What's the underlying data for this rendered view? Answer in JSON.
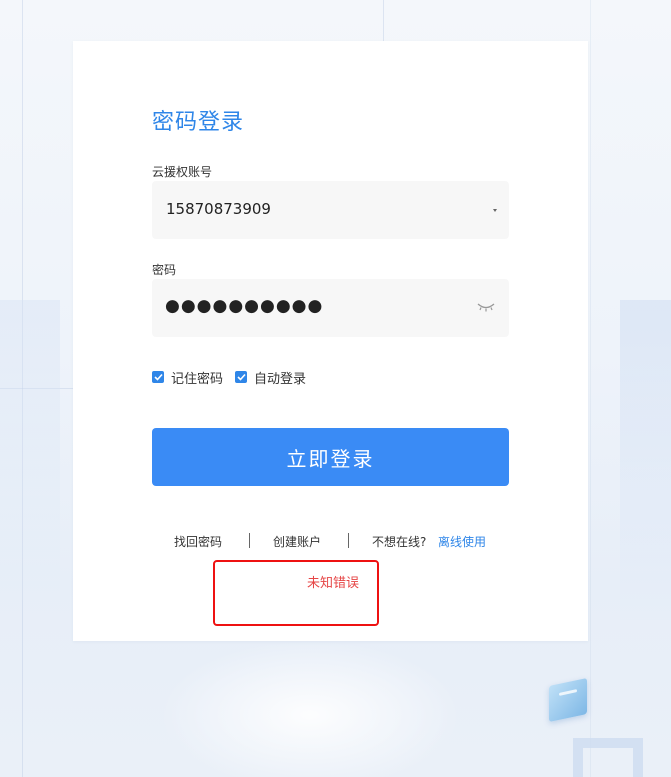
{
  "login": {
    "title": "密码登录",
    "account_label": "云援权账号",
    "account_value": "15870873909",
    "password_label": "密码",
    "password_value": "●●●●●●●●●●",
    "remember_password": {
      "label": "记住密码",
      "checked": true
    },
    "auto_login": {
      "label": "自动登录",
      "checked": true
    },
    "submit_label": "立即登录"
  },
  "links": {
    "recover_password": "找回密码",
    "create_account": "创建账户",
    "offline_prompt": "不想在线?",
    "offline_use": "离线使用"
  },
  "error": {
    "message": "未知错误"
  },
  "colors": {
    "accent": "#2f86e8",
    "button": "#3a8bf5",
    "error_text": "#e64545",
    "error_border": "#ee1111"
  },
  "icons": {
    "account_dropdown": "caret-down-icon",
    "password_visibility": "eye-closed-icon",
    "checkbox": "checkmark-icon"
  }
}
